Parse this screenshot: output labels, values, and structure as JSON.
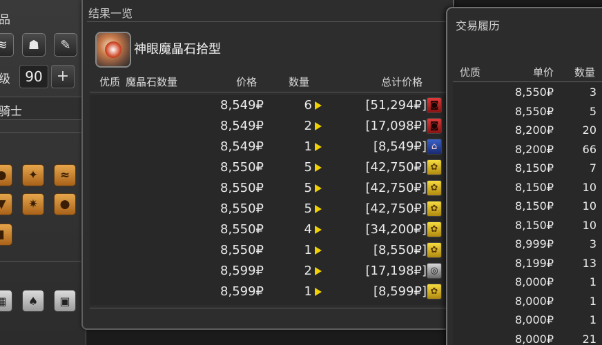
{
  "left_panel": {
    "item_label_partial": "品",
    "level_label_partial": "级",
    "level_value": "90",
    "level_plus": "+",
    "job_partial": "骑士"
  },
  "results": {
    "title": "结果一览",
    "item_name": "神眼魔晶石拾型",
    "headers": {
      "hq": "优质",
      "materia": "魔晶石数量",
      "price": "价格",
      "qty": "数量",
      "total": "总计价格"
    },
    "rows": [
      {
        "price": "8,549₽",
        "qty": "6",
        "total": "[51,294₽]",
        "retainer": "red"
      },
      {
        "price": "8,549₽",
        "qty": "2",
        "total": "[17,098₽]",
        "retainer": "red"
      },
      {
        "price": "8,549₽",
        "qty": "1",
        "total": "[8,549₽]",
        "retainer": "blue"
      },
      {
        "price": "8,550₽",
        "qty": "5",
        "total": "[42,750₽]",
        "retainer": "gold"
      },
      {
        "price": "8,550₽",
        "qty": "5",
        "total": "[42,750₽]",
        "retainer": "gold"
      },
      {
        "price": "8,550₽",
        "qty": "5",
        "total": "[42,750₽]",
        "retainer": "gold"
      },
      {
        "price": "8,550₽",
        "qty": "4",
        "total": "[34,200₽]",
        "retainer": "gold"
      },
      {
        "price": "8,550₽",
        "qty": "1",
        "total": "[8,550₽]",
        "retainer": "gold"
      },
      {
        "price": "8,599₽",
        "qty": "2",
        "total": "[17,198₽]",
        "retainer": "gray"
      },
      {
        "price": "8,599₽",
        "qty": "1",
        "total": "[8,599₽]",
        "retainer": "gold"
      }
    ]
  },
  "history": {
    "title": "交易履历",
    "headers": {
      "hq": "优质",
      "unit_price": "单价",
      "qty": "数量"
    },
    "rows": [
      {
        "price": "8,550₽",
        "qty": "3"
      },
      {
        "price": "8,550₽",
        "qty": "5"
      },
      {
        "price": "8,200₽",
        "qty": "20"
      },
      {
        "price": "8,200₽",
        "qty": "66"
      },
      {
        "price": "8,150₽",
        "qty": "7"
      },
      {
        "price": "8,150₽",
        "qty": "10"
      },
      {
        "price": "8,150₽",
        "qty": "10"
      },
      {
        "price": "8,150₽",
        "qty": "10"
      },
      {
        "price": "8,999₽",
        "qty": "3"
      },
      {
        "price": "8,199₽",
        "qty": "13"
      },
      {
        "price": "8,000₽",
        "qty": "1"
      },
      {
        "price": "8,000₽",
        "qty": "1"
      },
      {
        "price": "8,000₽",
        "qty": "1"
      },
      {
        "price": "8,000₽",
        "qty": "21"
      }
    ]
  },
  "colors": {
    "hq_arrow": "#f0d000",
    "retainer_red": "#c82828",
    "retainer_blue": "#2a44a0",
    "retainer_gold": "#e0b820",
    "retainer_gray": "#9a9a9a"
  },
  "icons": {
    "retainer_red": "cat-face-icon",
    "retainer_blue": "house-icon",
    "retainer_gold": "flower-icon",
    "retainer_gray": "swirl-icon"
  }
}
